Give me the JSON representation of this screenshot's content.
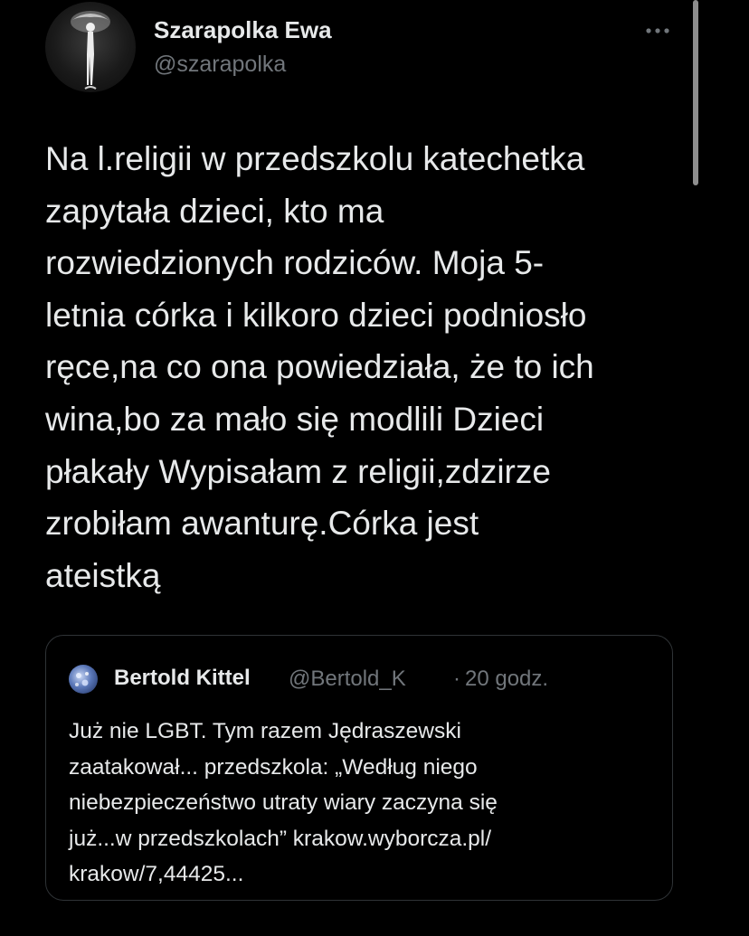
{
  "tweet": {
    "author": {
      "display_name": "Szarapolka Ewa",
      "handle": "@szarapolka"
    },
    "more_icon": "more-horizontal-icon",
    "text": "Na l.religii w przedszkolu katechetka\nzapytała dzieci, kto ma\nrozwiedzionych rodziców. Moja 5-\nletnia córka i kilkoro dzieci podniosło\nręce,na co ona powiedziała, że to ich\nwina,bo za mało się modlili Dzieci\npłakały Wypisałam z religii,zdzirze\nzrobiłam awanturę.Córka jest\nateistką"
  },
  "quoted_tweet": {
    "author": {
      "display_name": "Bertold Kittel",
      "handle": "@Bertold_K"
    },
    "separator": "·",
    "time": "20 godz.",
    "text": "Już nie LGBT. Tym razem Jędraszewski\nzaatakował... przedszkola: „Według niego\nniebezpieczeństwo utraty wiary zaczyna się\njuż...w przedszkolach” krakow.wyborcza.pl/\nkrakow/7,44425..."
  },
  "colors": {
    "background": "#000000",
    "primary_text": "#e7e9ea",
    "secondary_text": "#71767b",
    "border": "#2f3336"
  }
}
